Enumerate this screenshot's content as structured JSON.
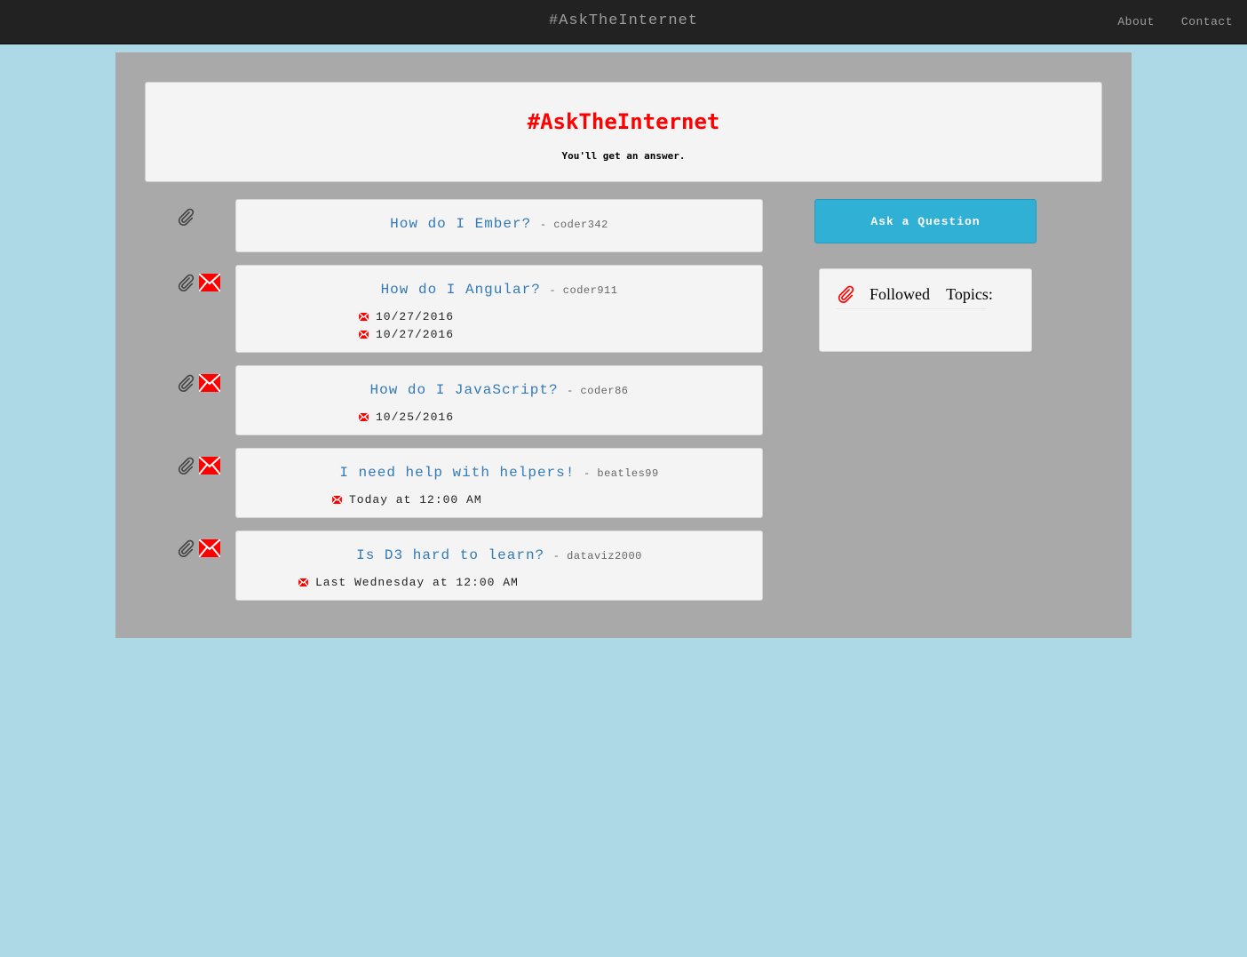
{
  "navbar": {
    "brand": "#AskTheInternet",
    "links": [
      "About",
      "Contact"
    ]
  },
  "jumbotron": {
    "title": "#AskTheInternet",
    "subtitle": "You'll get an answer."
  },
  "questions": [
    {
      "title": "How do I Ember?",
      "author": "- coder342",
      "has_answers": false,
      "answers": []
    },
    {
      "title": "How do I Angular?",
      "author": "- coder911",
      "has_answers": true,
      "answers": [
        "10/27/2016",
        "10/27/2016"
      ]
    },
    {
      "title": "How do I JavaScript?",
      "author": "- coder86",
      "has_answers": true,
      "answers": [
        "10/25/2016"
      ]
    },
    {
      "title": "I need help with helpers!",
      "author": "- beatles99",
      "has_answers": true,
      "answers": [
        "Today at 12:00 AM"
      ]
    },
    {
      "title": "Is D3 hard to learn?",
      "author": "- dataviz2000",
      "has_answers": true,
      "answers": [
        "Last Wednesday at 12:00 AM"
      ]
    }
  ],
  "sidebar": {
    "ask_button": "Ask a Question",
    "followed_title": "Followed Topics:"
  },
  "colors": {
    "accent": "#31b0d5",
    "brand_red": "#ff0000",
    "link_blue": "#337ab7",
    "page_bg": "#add8e6",
    "panel_bg": "#a9a9a9"
  },
  "icons": {
    "follow": "paperclip-icon",
    "answers": "envelope-icon"
  }
}
